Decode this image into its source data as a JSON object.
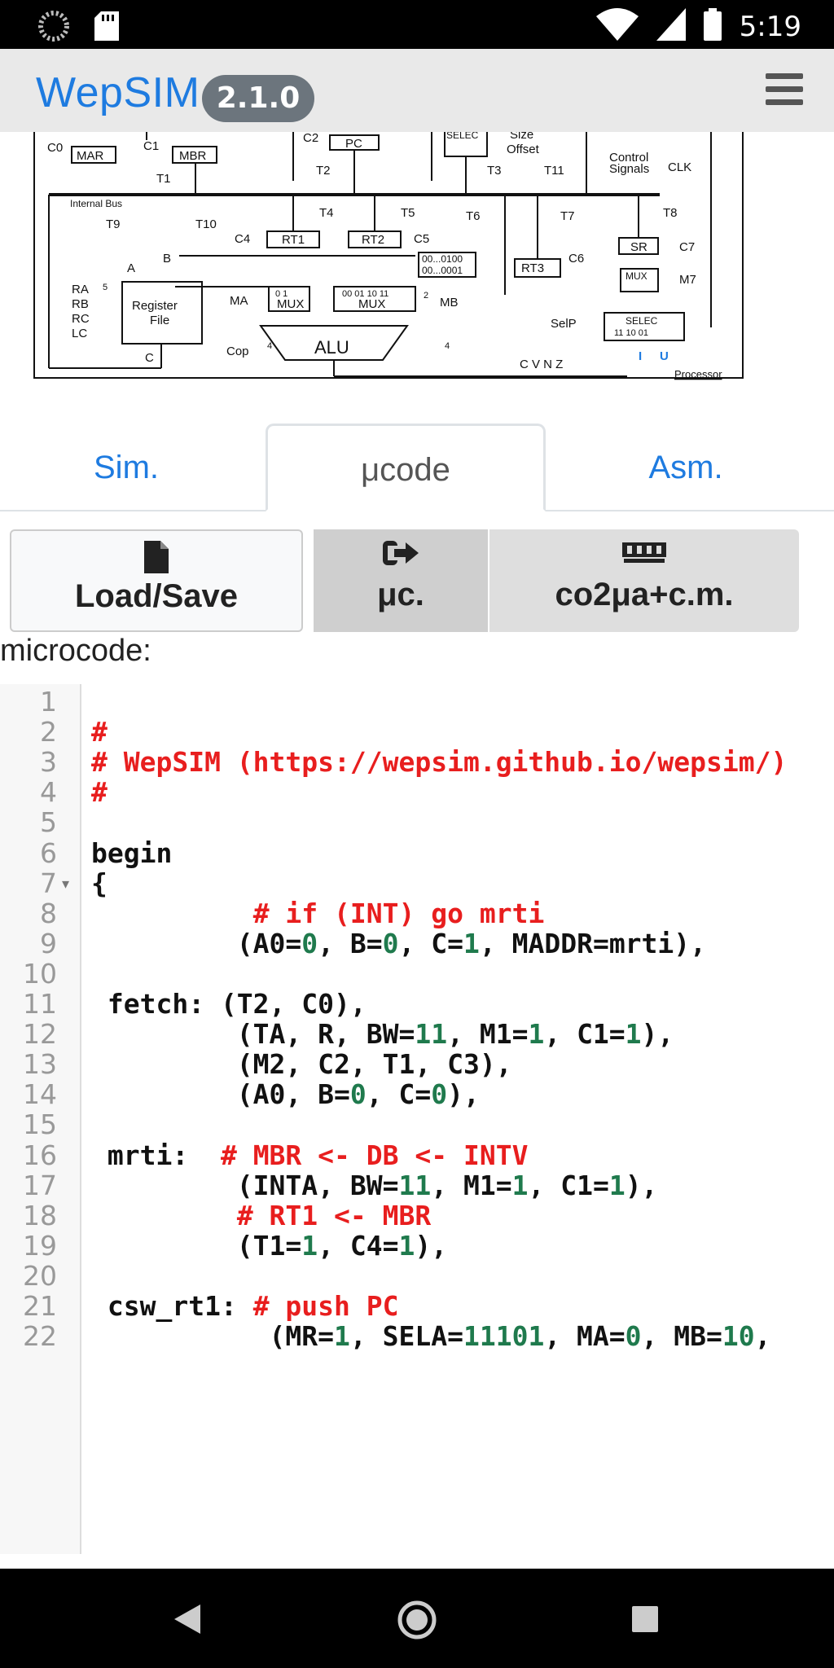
{
  "status_bar": {
    "time": "5:19"
  },
  "header": {
    "app_name": "WepSIM",
    "version": "2.1.0"
  },
  "diagram": {
    "labels": {
      "c0": "C0",
      "mar": "MAR",
      "c1": "C1",
      "mbr": "MBR",
      "c2": "C2",
      "pc": "PC",
      "selec_top": "SELEC",
      "size": "Size",
      "offset": "Offset",
      "control": "Control",
      "signals": "Signals",
      "clk": "CLK",
      "t1": "T1",
      "t2": "T2",
      "t3": "T3",
      "t11": "T11",
      "internal_bus": "Internal Bus",
      "t4": "T4",
      "t5": "T5",
      "t6": "T6",
      "t7": "T7",
      "t8": "T8",
      "t9": "T9",
      "t10": "T10",
      "c4": "C4",
      "rt1": "RT1",
      "rt2": "RT2",
      "c5": "C5",
      "rt3": "RT3",
      "c6": "C6",
      "sr": "SR",
      "c7": "C7",
      "bits1": "00...0100",
      "bits2": "00...0001",
      "a": "A",
      "b": "B",
      "ra": "RA",
      "rb": "RB",
      "rc": "RC",
      "lc": "LC",
      "five": "5",
      "register": "Register",
      "file": "File",
      "ma": "MA",
      "mux": "MUX",
      "mux_in": "0   1",
      "mux4_in": "00  01  10  11",
      "mb": "MB",
      "two": "2",
      "mux_m7": "MUX",
      "m7": "M7",
      "selp": "SelP",
      "selec": "SELEC",
      "selec_in": "11   10   01",
      "cop": "Cop",
      "four": "4",
      "alu": "ALU",
      "c": "C",
      "cvnz": "C   V   N   Z",
      "i": "I",
      "u": "U",
      "processor": "Processor"
    }
  },
  "tabs": [
    {
      "label": "Sim."
    },
    {
      "label": "μcode"
    },
    {
      "label": "Asm."
    }
  ],
  "toolbar": {
    "load_save": "Load/Save",
    "uc": "μc.",
    "co2": "co2μa+c.m."
  },
  "section_label": "microcode:",
  "editor": {
    "lines": [
      {
        "n": "1",
        "text": ""
      },
      {
        "n": "2",
        "text": "#"
      },
      {
        "n": "3",
        "text": "# WepSIM (https://wepsim.github.io/wepsim/)"
      },
      {
        "n": "4",
        "text": "#"
      },
      {
        "n": "5",
        "text": ""
      },
      {
        "n": "6",
        "text": "begin"
      },
      {
        "n": "7",
        "text": "{",
        "fold": true
      },
      {
        "n": "8",
        "text": "          # if (INT) go mrti"
      },
      {
        "n": "9",
        "text": "         (A0=0, B=0, C=1, MADDR=mrti),"
      },
      {
        "n": "10",
        "text": ""
      },
      {
        "n": "11",
        "text": " fetch: (T2, C0),"
      },
      {
        "n": "12",
        "text": "         (TA, R, BW=11, M1=1, C1=1),"
      },
      {
        "n": "13",
        "text": "         (M2, C2, T1, C3),"
      },
      {
        "n": "14",
        "text": "         (A0, B=0, C=0),"
      },
      {
        "n": "15",
        "text": ""
      },
      {
        "n": "16",
        "text": " mrti:  # MBR <- DB <- INTV"
      },
      {
        "n": "17",
        "text": "         (INTA, BW=11, M1=1, C1=1),"
      },
      {
        "n": "18",
        "text": "         # RT1 <- MBR"
      },
      {
        "n": "19",
        "text": "         (T1=1, C4=1),"
      },
      {
        "n": "20",
        "text": ""
      },
      {
        "n": "21",
        "text": " csw_rt1: # push PC"
      },
      {
        "n": "22",
        "text": "           (MR=1, SELA=11101, MA=0, MB=10,"
      }
    ]
  },
  "colors": {
    "accent": "#1e7be0",
    "comment": "#e81e1e",
    "number": "#1f7a4d",
    "version_badge": "#6c757d"
  }
}
